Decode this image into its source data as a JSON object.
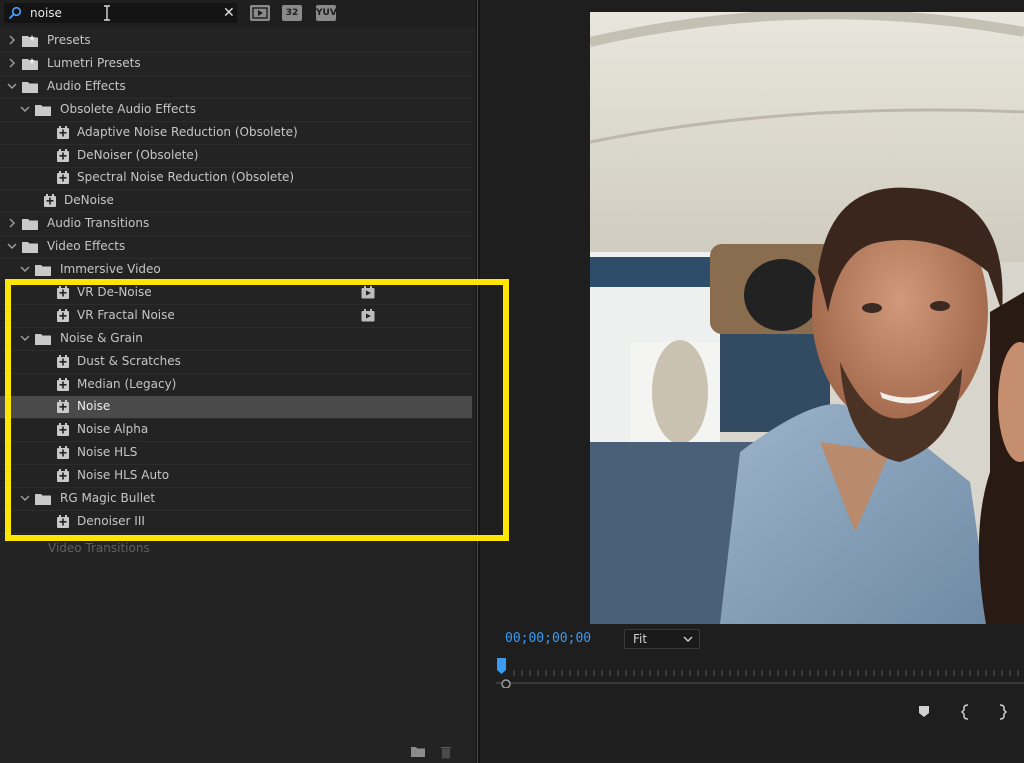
{
  "search": {
    "value": "noise"
  },
  "toolbar": {
    "accelerated_badge": "",
    "bit_badge": "32",
    "yuv_badge": "YUV"
  },
  "tree": [
    {
      "label": "Presets",
      "type": "folder",
      "depth": 0,
      "expanded": false
    },
    {
      "label": "Lumetri Presets",
      "type": "folder",
      "depth": 0,
      "expanded": false
    },
    {
      "label": "Audio Effects",
      "type": "folder",
      "depth": 0,
      "expanded": true
    },
    {
      "label": "Obsolete Audio Effects",
      "type": "folder",
      "depth": 1,
      "expanded": true
    },
    {
      "label": "Adaptive Noise Reduction (Obsolete)",
      "type": "effect",
      "depth": 2
    },
    {
      "label": "DeNoiser (Obsolete)",
      "type": "effect",
      "depth": 2
    },
    {
      "label": "Spectral Noise Reduction (Obsolete)",
      "type": "effect",
      "depth": 2
    },
    {
      "label": "DeNoise",
      "type": "effect",
      "depth": 1
    },
    {
      "label": "Audio Transitions",
      "type": "folder",
      "depth": 0,
      "expanded": false
    },
    {
      "label": "Video Effects",
      "type": "folder",
      "depth": 0,
      "expanded": true
    },
    {
      "label": "Immersive Video",
      "type": "folder",
      "depth": 1,
      "expanded": true
    },
    {
      "label": "VR De-Noise",
      "type": "effect",
      "depth": 2,
      "gpu": true
    },
    {
      "label": "VR Fractal Noise",
      "type": "effect",
      "depth": 2,
      "gpu": true
    },
    {
      "label": "Noise & Grain",
      "type": "folder",
      "depth": 1,
      "expanded": true
    },
    {
      "label": "Dust & Scratches",
      "type": "effect",
      "depth": 2
    },
    {
      "label": "Median (Legacy)",
      "type": "effect",
      "depth": 2
    },
    {
      "label": "Noise",
      "type": "effect",
      "depth": 2,
      "selected": true
    },
    {
      "label": "Noise Alpha",
      "type": "effect",
      "depth": 2
    },
    {
      "label": "Noise HLS",
      "type": "effect",
      "depth": 2
    },
    {
      "label": "Noise HLS Auto",
      "type": "effect",
      "depth": 2
    },
    {
      "label": "RG Magic Bullet",
      "type": "folder",
      "depth": 1,
      "expanded": true
    },
    {
      "label": "Denoiser III",
      "type": "effect",
      "depth": 2
    }
  ],
  "ghost_row": "Video Transitions",
  "monitor": {
    "timecode": "00;00;00;00",
    "zoom": "Fit"
  },
  "colors": {
    "highlight": "#ffe600",
    "timecode": "#3b9bf0",
    "panel": "#232323"
  },
  "icons": {
    "search": "search-icon",
    "clear": "close-icon",
    "folder": "folder-icon",
    "effect": "effect-icon",
    "gpu": "gpu-accelerated-icon",
    "new_bin": "new-bin-icon",
    "delete": "trash-icon"
  }
}
